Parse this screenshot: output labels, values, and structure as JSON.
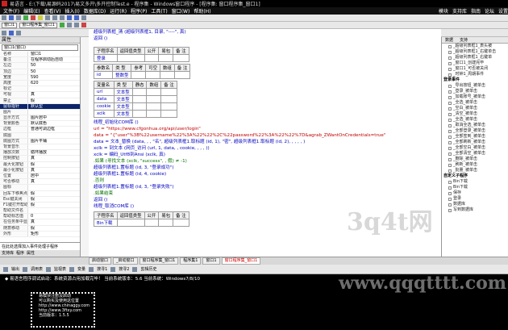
{
  "window": {
    "title": "易语言 - E:\\下载\\易源码2017\\易文多开\\多开控制Test.e - 程序集 - Windows窗口程序 - [程序集: 窗口程序集_窗口1]"
  },
  "menubar": {
    "items": [
      "文件(F)",
      "编辑(E)",
      "查看(V)",
      "插入(I)",
      "数据库(D)",
      "运行(R)",
      "程序(P)",
      "工具(T)",
      "窗口(W)",
      "帮助(H)"
    ],
    "right": [
      "模块",
      "支持库",
      "指南",
      "论坛",
      "设置"
    ]
  },
  "toolbar": {
    "combo_left": "窗口1",
    "combo_right": "窗口程序集_窗口1"
  },
  "left_panel": {
    "header": "属性",
    "selector": "窗口1(窗口)",
    "props": [
      [
        "名称",
        "窗口1"
      ],
      [
        "备注",
        "在程序启动后自动"
      ],
      [
        "左边",
        "50"
      ],
      [
        "顶边",
        "50"
      ],
      [
        "宽度",
        "590"
      ],
      [
        "高度",
        "620"
      ],
      [
        "标记",
        ""
      ],
      [
        "可视",
        "真"
      ],
      [
        "禁止",
        "假"
      ],
      [
        "鼠标指针",
        "默认型"
      ],
      [
        "图片",
        ""
      ],
      [
        "显示方式",
        "图片居中"
      ],
      [
        "背景颜色",
        "默认底色"
      ],
      [
        "边框",
        "普通可调边框"
      ],
      [
        "底图",
        ""
      ],
      [
        "底图方式",
        "图片平铺"
      ],
      [
        "背景音乐",
        ""
      ],
      [
        "播放次数",
        "循环播放"
      ],
      [
        "控制按钮",
        "真"
      ],
      [
        "最大化按钮",
        "假"
      ],
      [
        "最小化按钮",
        "真"
      ],
      [
        "位置",
        "居中"
      ],
      [
        "可否移动",
        "真"
      ],
      [
        "图标",
        ""
      ],
      [
        "回车下移焦点",
        "假"
      ],
      [
        "Esc键关闭",
        "假"
      ],
      [
        "F1键打开帮助",
        "假"
      ],
      [
        "帮助文件名",
        ""
      ],
      [
        "帮助标志值",
        "0"
      ],
      [
        "在任务条中显示",
        "真"
      ],
      [
        "随意移动",
        "假"
      ],
      [
        "外形",
        "矩形"
      ]
    ],
    "highlight_index": 9,
    "help_text": "在此处选择加入事件处理子程序",
    "bottom_tabs": [
      "支持库",
      "程序",
      "属性"
    ]
  },
  "code": {
    "top_lines": [
      "超级列表框_清 (超级列表框1, 目录, \"----\", 真)",
      "返回 ()"
    ],
    "sub_header": [
      "子程序名",
      "返回值类型",
      "公开",
      "易包",
      "备 注"
    ],
    "sub_name": "登录",
    "param_header": [
      "参数名",
      "类 型",
      "参考",
      "可空",
      "数组",
      "备 注"
    ],
    "param_row": [
      "id",
      "整数型",
      "",
      "",
      "",
      ""
    ],
    "var_header": [
      "变量名",
      "类 型",
      "静态",
      "数组",
      "备 注"
    ],
    "vars": [
      [
        "url",
        "文本型"
      ],
      [
        "data",
        "文本型"
      ],
      [
        "cookie",
        "文本型"
      ],
      [
        "xclk",
        "文本型"
      ]
    ],
    "lines": [
      "线程_初始化COM库 ()",
      "url = \"https://www.cfgonhua.org/api/user/login\"",
      "data = \"{\"user\"%3B%22username%22%3A%22%22%2C%22password%22%3A%22%22%7D&agrab_ZWantOnCredentials=true\"",
      "data = 文本_替换 (data, , , \"名\", 超级列表框1.取标题 (id, 1), \"密\", 超级列表框1.取标题 (id, 2), , , , , )",
      "xclk = 到文本 (网页_访问 (url, 1, data, , cookie, , , , ))",
      "xclk = 编码_Utf8到Ansi (xclk, 真)",
      ".如果 (寻找文本 (xclk, \"success\", , 假) ≠ -1)",
      "    超级列表框1.置标题 (id, 3, \"登录成功\")",
      "    超级列表框1.置标题 (id, 4, cookie)",
      ".否则",
      "    超级列表框1.置标题 (id, 3, \"登录失败\")",
      ".如果结束",
      "返回 ()",
      "线程_取消COM库 ()"
    ],
    "sub2_header": [
      "子程序名",
      "返回值类型",
      "公开",
      "易包",
      "备 注"
    ],
    "sub2_name": "Bin下载"
  },
  "right_panel": {
    "tabs": [
      "数据",
      "支持"
    ],
    "groups": [
      {
        "name": "",
        "items": [
          "_超级列表框1_表头被",
          "_超级列表框1_右键单击",
          "_超级列表框1_右键单",
          "_窗口1_创建完毕",
          "_窗口1_可否被关闭",
          "_时钟1_周期事件"
        ]
      },
      {
        "name": "登录事件",
        "items": [
          "_导出按钮_被单击",
          "_登录_被单击",
          "_加载账号_被单击",
          "_全选_被单击",
          "_空白_被单击",
          "_清空_被单击",
          "_全选_被单击",
          "_取消全选_被单击",
          "_全部登录_被单击",
          "_全部签到_被单击",
          "_全部刷新_被单击",
          "_全部空白_被单击",
          "_全部清空_被单击",
          "_删除_被单击",
          "_刷新_被单击",
          "_批量_被单击"
        ]
      },
      {
        "name": "自定义子程序",
        "items": [
          "Bin下载",
          "Bin下载",
          "保存",
          "登录",
          "数据库",
          "写到数据库"
        ]
      }
    ]
  },
  "bottom_tabs": {
    "tabs": [
      "启动窗口",
      "_启动窗口",
      "窗口程序集_窗口1",
      "程序集1",
      "窗口1",
      "窗口程序集_窗口1"
    ],
    "active_index": 5
  },
  "output_toolbar": {
    "items": [
      "输出",
      "调用表",
      "监视表",
      "变量",
      "搜寻1",
      "搜寻2",
      "剪辑历史"
    ]
  },
  "console": {
    "line1": "◆ 易语言程序调试启动：系统资源占用加载完毕！ 当前系统版本：5.6 当前系统：Windows7/8/10",
    "box_lines": [
      "易模块注册及启动",
      "可以购买及使用这位置",
      "http://www.chinaggy.com",
      "http://www.3ftxy.com",
      "当前版本：1.5.5"
    ]
  },
  "watermarks": [
    "3q4t网",
    "www.qqqtttt.com"
  ]
}
